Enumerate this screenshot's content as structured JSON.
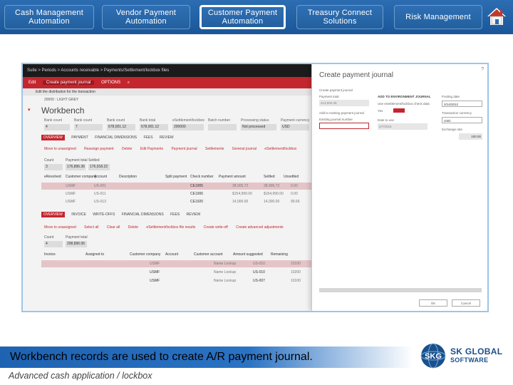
{
  "nav": {
    "items": [
      {
        "label": "Cash Management\nAutomation",
        "active": false
      },
      {
        "label": "Vendor  Payment\nAutomation",
        "active": false
      },
      {
        "label": "Customer Payment\nAutomation",
        "active": true
      },
      {
        "label": "Treasury Connect\nSolutions",
        "active": false
      },
      {
        "label": "Risk Management",
        "active": false
      }
    ],
    "home_icon": "home-icon"
  },
  "screenshot": {
    "breadcrumb": "Suite  >  Periods  >  Accounts receivable  >  Payments/Settlement/lockbox files",
    "toolbar": {
      "edit": "Edit",
      "create": "Create payment journal",
      "options": "OPTIONS"
    },
    "subbar": "Edit the distribution for the transaction",
    "record_label": "20000 : LIGHT GREY",
    "title": "Workbench",
    "filters": [
      {
        "label": "Bank count",
        "value": "4"
      },
      {
        "label": "Bank count",
        "value": "7"
      },
      {
        "label": "Bank count",
        "value": "678,001.12"
      },
      {
        "label": "Bank total",
        "value": "678,001.12"
      },
      {
        "label": "eSettlement/lockbox",
        "value": "200000"
      },
      {
        "label": "Batch number",
        "value": ""
      },
      {
        "label": "Processing status",
        "value": "Not processed"
      },
      {
        "label": "Payment currency",
        "value": "USD"
      }
    ],
    "tabs1": [
      "OVERVIEW",
      "PAYMENT",
      "FINANCIAL DIMENSIONS",
      "FEES",
      "REVIEW"
    ],
    "actions1": [
      "Move to unassigned",
      "Reassign payment",
      "Delete",
      "Edit Payments",
      "Payment journal",
      "Settlements",
      "General journal",
      "eSettlement/lockbox"
    ],
    "count_label": "Count",
    "count_value": "3",
    "payment_total_label": "Payment total",
    "payment_total_value": "176,896.36",
    "settled_label": "Settled",
    "settled_value": "176,918.22",
    "grid1_headers": [
      "eResolved",
      "Customer company",
      "Account",
      "Description",
      "Split payment",
      "Check number",
      "Payment amount",
      "Settled",
      "Unsettled"
    ],
    "grid1_rows": [
      [
        "",
        "USMF",
        "US-001",
        "",
        "",
        "CE1905",
        "38,905.72",
        "38,905.72",
        "0.00"
      ],
      [
        "",
        "USMF",
        "US-011",
        "",
        "",
        "CE1906",
        "$154,990.00",
        "$154,990.00",
        "0.00"
      ],
      [
        "",
        "USMF",
        "US-013",
        "",
        "",
        "CE1920",
        "14,000.00",
        "14,000.00",
        "99.66"
      ]
    ],
    "tabs2": [
      "OVERVIEW",
      "INVOICE",
      "WRITE-OFFS",
      "FINANCIAL DIMENSIONS",
      "FEES",
      "REVIEW"
    ],
    "actions2": [
      "Move to unassigned",
      "Select all",
      "Clear all",
      "Delete",
      "eSettlement/lockbox file results",
      "Create write-off",
      "Create advanced adjustments"
    ],
    "count2_value": "4",
    "payment2_value": "208,896.06",
    "grid2_headers": [
      "Invoice",
      "Assigned to",
      "Customer company",
      "Account",
      "Customer account",
      "Amount suggested",
      "Remaining"
    ],
    "grid2_rows": [
      [
        "",
        "",
        "USMF",
        "",
        "Name Lookup",
        "US-010",
        "10100"
      ],
      [
        "",
        "",
        "USMF",
        "",
        "Name Lookup",
        "US-010",
        "10200"
      ],
      [
        "",
        "",
        "USMF",
        "",
        "Name Lookup",
        "US-007",
        "10100"
      ]
    ],
    "dialog": {
      "title": "Create payment journal",
      "help": "?",
      "section": "Create payment journal",
      "payment_total_label": "Payment total",
      "payment_total_value": "413,900.36",
      "journal_label": "Add to existing payment journal",
      "journal_name_label": "Existing journal number",
      "add_header": "ADD TO ENVIRONMENT JOURNAL",
      "use_check_label": "Use eSettlement/lockbox check data",
      "yes_label": "Yes",
      "date_to_use_label": "Date to use",
      "date_to_use_value": "2/7/2016",
      "posting_date_label": "Posting date",
      "posting_date_value": "2/14/2012",
      "currency_label": "Transaction currency",
      "currency_value": "USD",
      "exchange_label": "Exchange rate",
      "exchange_value": "100.00",
      "ok": "OK",
      "cancel": "Cancel"
    }
  },
  "caption": "Workbench records are used to create A/R payment journal.",
  "subtitle": "Advanced cash application / lockbox",
  "logo": {
    "mark": "SKG",
    "title": "SK GLOBAL",
    "sub": "SOFTWARE"
  },
  "colors": {
    "nav_blue": "#2c6db2",
    "accent_red": "#c4262e",
    "caption_blue": "#1e63b1"
  }
}
